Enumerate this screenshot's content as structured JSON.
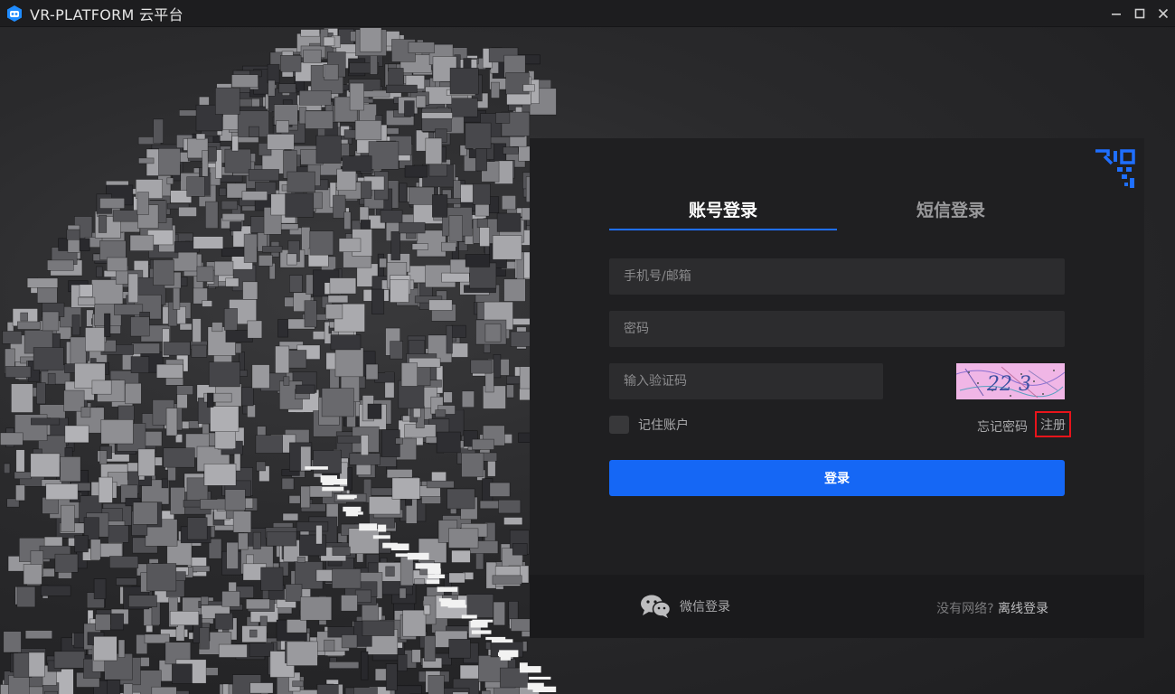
{
  "window": {
    "title": "VR-PLATFORM 云平台",
    "logo_icon": "vr-platform-logo-icon",
    "controls": [
      "minimize-icon",
      "maximize-icon",
      "close-icon"
    ]
  },
  "login": {
    "tabs": [
      {
        "label": "账号登录",
        "active": true
      },
      {
        "label": "短信登录",
        "active": false
      }
    ],
    "fields": {
      "phone_placeholder": "手机号/邮箱",
      "password_placeholder": "密码",
      "captcha_placeholder": "输入验证码"
    },
    "captcha_text": "22 3",
    "remember_label": "记住账户",
    "forgot_label": "忘记密码",
    "register_label": "注册",
    "login_button": "登录",
    "qr_icon": "qr-code-corner-icon"
  },
  "footer": {
    "wechat_label": "微信登录",
    "offline_question": "没有网络?",
    "offline_link": "离线登录"
  },
  "colors": {
    "accent": "#1567f5",
    "panel_bg": "#1f1f21",
    "field_bg": "#2c2c2e",
    "highlight": "#e8141b"
  }
}
